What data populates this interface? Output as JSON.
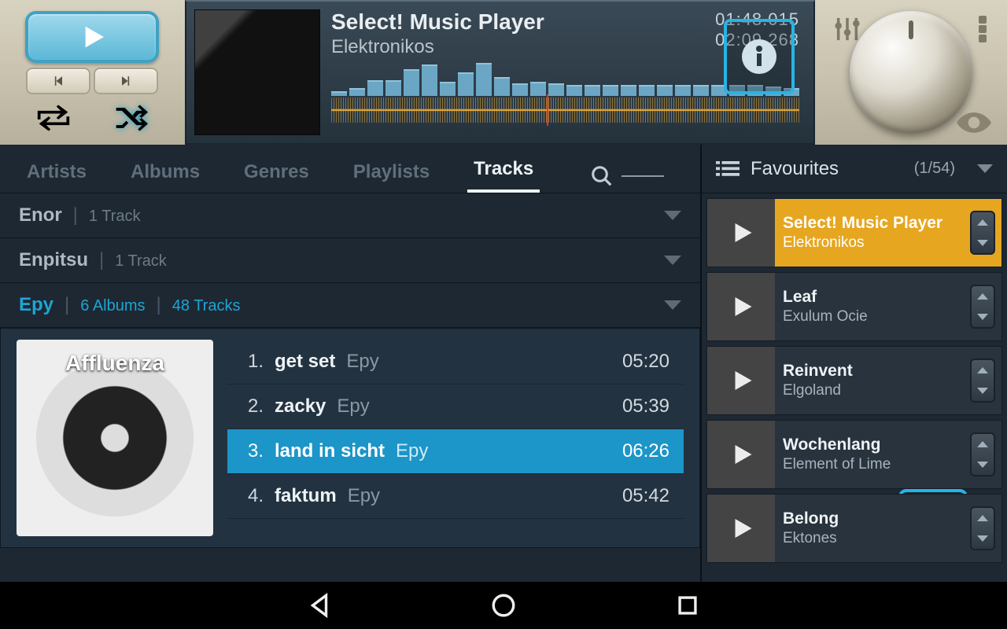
{
  "nowplaying": {
    "title": "Select! Music Player",
    "artist": "Elektronikos",
    "elapsed": "01:48.015",
    "total": "02:09.268",
    "spectrum": [
      6,
      10,
      20,
      20,
      34,
      40,
      18,
      30,
      42,
      24,
      16,
      18,
      16,
      14,
      14,
      14,
      14,
      14,
      14,
      14,
      14,
      14,
      14,
      14,
      12,
      10
    ]
  },
  "tabs": [
    "Artists",
    "Albums",
    "Genres",
    "Playlists",
    "Tracks"
  ],
  "active_tab": "Tracks",
  "groups": [
    {
      "name": "Enor",
      "meta": [
        "1 Track"
      ],
      "expanded": false
    },
    {
      "name": "Enpitsu",
      "meta": [
        "1 Track"
      ],
      "expanded": false
    },
    {
      "name": "Epy",
      "meta": [
        "6 Albums",
        "48 Tracks"
      ],
      "expanded": true,
      "album": "Affluenza",
      "tracks": [
        {
          "n": "1.",
          "title": "get set",
          "artist": "Epy",
          "dur": "05:20",
          "sel": false
        },
        {
          "n": "2.",
          "title": "zacky",
          "artist": "Epy",
          "dur": "05:39",
          "sel": false
        },
        {
          "n": "3.",
          "title": "land in sicht",
          "artist": "Epy",
          "dur": "06:26",
          "sel": true
        },
        {
          "n": "4.",
          "title": "faktum",
          "artist": "Epy",
          "dur": "05:42",
          "sel": false
        }
      ]
    }
  ],
  "favourites": {
    "title": "Favourites",
    "count": "(1/54)",
    "items": [
      {
        "title": "Select! Music Player",
        "artist": "Elektronikos",
        "sel": true
      },
      {
        "title": "Leaf",
        "artist": "Exulum Ocie",
        "sel": false
      },
      {
        "title": "Reinvent",
        "artist": "Elgoland",
        "sel": false
      },
      {
        "title": "Wochenlang",
        "artist": "Element of Lime",
        "sel": false
      },
      {
        "title": "Belong",
        "artist": "Ektones",
        "sel": false
      }
    ]
  }
}
